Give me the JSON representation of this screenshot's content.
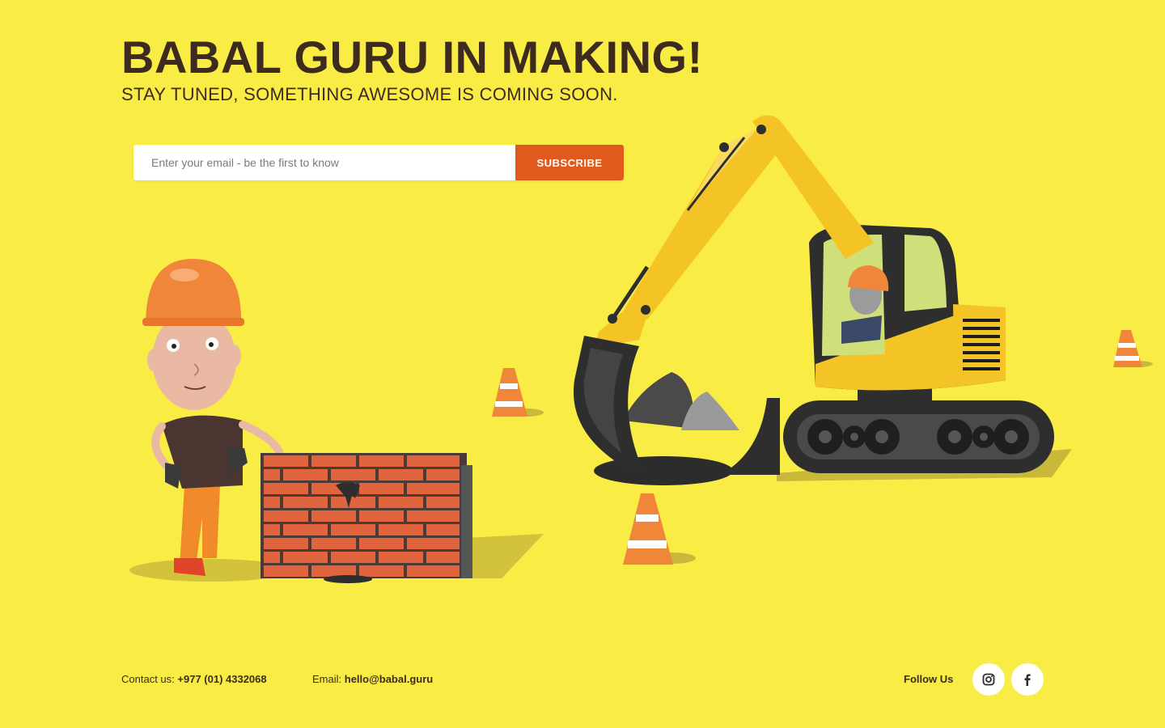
{
  "header": {
    "title": "BABAL GURU IN MAKING!",
    "subtitle": "STAY TUNED, SOMETHING AWESOME IS COMING SOON."
  },
  "subscribe": {
    "placeholder": "Enter your email - be the first to know",
    "button_label": "SUBSCRIBE"
  },
  "footer": {
    "contact_label": "Contact us:",
    "contact_phone": "+977 (01) 4332068",
    "email_label": "Email:",
    "email_value": "hello@babal.guru",
    "follow_label": "Follow Us",
    "social": [
      {
        "icon": "instagram-icon"
      },
      {
        "icon": "facebook-icon"
      }
    ]
  },
  "colors": {
    "background": "#f9ed45",
    "accent": "#e05a1d",
    "text": "#3d2b1f"
  }
}
